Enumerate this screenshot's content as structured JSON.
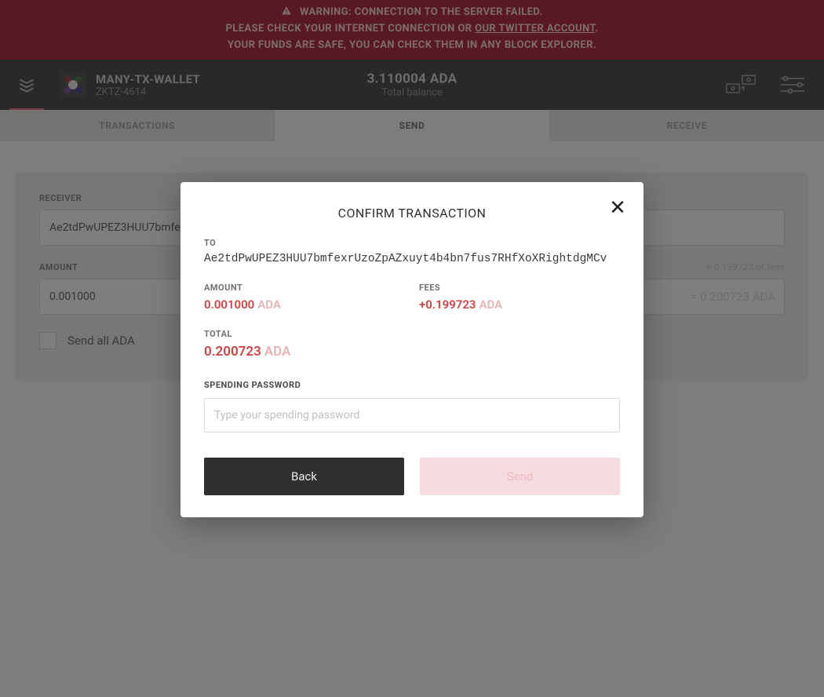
{
  "banner": {
    "line1_prefix": "WARNING: CONNECTION TO THE SERVER FAILED.",
    "line2_prefix": "PLEASE CHECK YOUR INTERNET CONNECTION OR ",
    "line2_link": "OUR TWITTER ACCOUNT",
    "line2_suffix": ".",
    "line3": "YOUR FUNDS ARE SAFE, YOU CAN CHECK THEM IN ANY BLOCK EXPLORER."
  },
  "header": {
    "wallet_name": "MANY-TX-WALLET",
    "wallet_code": "ZKTZ-4614",
    "balance_amount": "3.110004 ADA",
    "balance_label": "Total balance"
  },
  "tabs": {
    "transactions": "TRANSACTIONS",
    "send": "SEND",
    "receive": "RECEIVE"
  },
  "form": {
    "receiver_label": "RECEIVER",
    "receiver_value": "Ae2tdPwUPEZ3HUU7bmfexrUzoZpAZxuyt4b4bn7fus7RHfXoXRightdgMCv",
    "amount_label": "AMOUNT",
    "amount_value": "0.001000",
    "fees_hint": "+ 0.199723 of fees",
    "amount_total": "= 0.200723 ADA",
    "send_all_label": "Send all ADA"
  },
  "modal": {
    "title": "CONFIRM TRANSACTION",
    "to_label": "TO",
    "to_value": "Ae2tdPwUPEZ3HUU7bmfexrUzoZpAZxuyt4b4bn7fus7RHfXoXRightdgMCv",
    "amount_label": "AMOUNT",
    "amount_value": "0.001000",
    "amount_currency": "ADA",
    "fees_label": "FEES",
    "fees_value": "+0.199723",
    "fees_currency": "ADA",
    "total_label": "TOTAL",
    "total_value": "0.200723",
    "total_currency": "ADA",
    "password_label": "SPENDING PASSWORD",
    "password_placeholder": "Type your spending password",
    "back_label": "Back",
    "send_label": "Send"
  },
  "colors": {
    "banner_bg": "#9f0a22",
    "accent_red": "#cf4242",
    "accent_red_light": "#e8b3b3"
  }
}
